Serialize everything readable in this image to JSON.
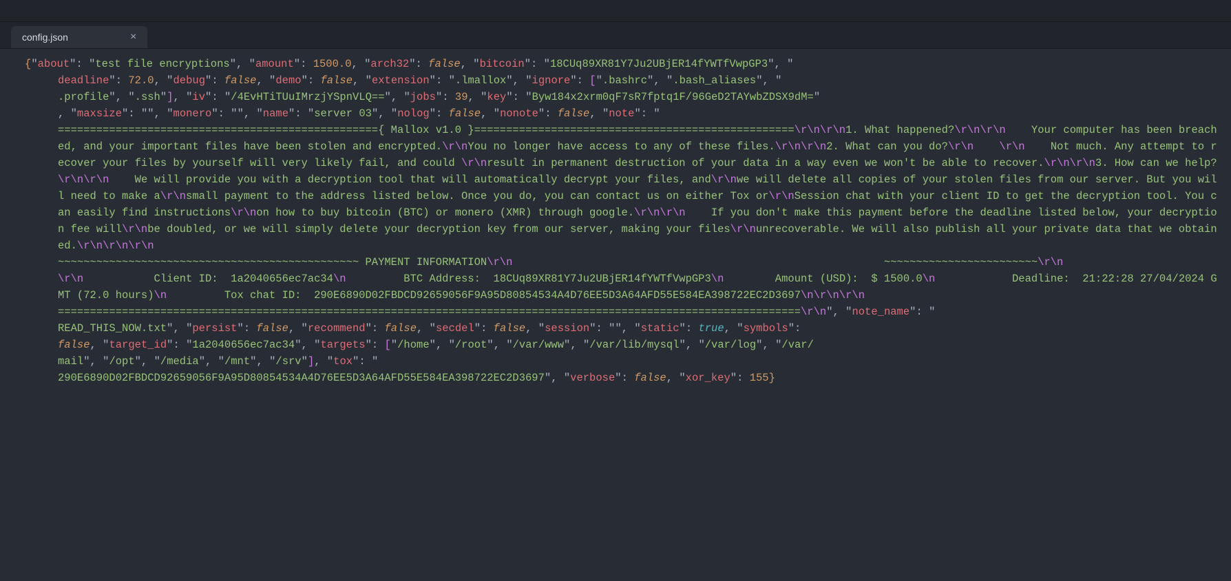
{
  "tab": {
    "filename": "config.json",
    "close_glyph": "×"
  },
  "json": {
    "about_key": "about",
    "about_val": "test file encryptions",
    "amount_key": "amount",
    "amount_val": "1500.0",
    "arch32_key": "arch32",
    "arch32_val": "false",
    "bitcoin_key": "bitcoin",
    "bitcoin_val": "18CUq89XR81Y7Ju2UBjER14fYWTfVwpGP3",
    "deadline_key": "deadline",
    "deadline_val": "72.0",
    "debug_key": "debug",
    "debug_val": "false",
    "demo_key": "demo",
    "demo_val": "false",
    "extension_key": "extension",
    "extension_val": ".lmallox",
    "ignore_key": "ignore",
    "ignore_vals": [
      ".bashrc",
      ".bash_aliases",
      ".profile",
      ".ssh"
    ],
    "iv_key": "iv",
    "iv_val": "/4EvHTiTUuIMrzjYSpnVLQ==",
    "jobs_key": "jobs",
    "jobs_val": "39",
    "key_key": "key",
    "key_val": "Byw184x2xrm0qF7sR7fptq1F/96GeD2TAYwbZDSX9dM=",
    "maxsize_key": "maxsize",
    "maxsize_val": "",
    "monero_key": "monero",
    "monero_val": "",
    "name_key": "name",
    "name_val": "server 03",
    "nolog_key": "nolog",
    "nolog_val": "false",
    "nonote_key": "nonote",
    "nonote_val": "false",
    "note_key": "note",
    "note_seg1": "=================================================={ Mallox v1.0 }==================================================",
    "note_seg2": "1. What happened?",
    "note_seg3": "    Your computer has been breached, and your important files have been stolen and encrypted.",
    "note_seg4": "You no longer have access to any of these files.",
    "note_seg5": "2. What can you do?",
    "note_seg5b": "    ",
    "note_seg6": "    Not much. Any attempt to recover your files by yourself will very likely fail, and could ",
    "note_seg7": "result in permanent destruction of your data in a way even we won't be able to recover.",
    "note_seg8": "3. How can we help?",
    "note_seg9": "    We will provide you with a decryption tool that will automatically decrypt your files, and",
    "note_seg10": "we will delete all copies of your stolen files from our server. But you will need to make a",
    "note_seg11": "small payment to the address listed below. Once you do, you can contact us on either Tox or",
    "note_seg12": "Session chat with your client ID to get the decryption tool. You can easily find instructions",
    "note_seg13": "on how to buy bitcoin (BTC) or monero (XMR) through google.",
    "note_seg14": "    If you don't make this payment before the deadline listed below, your decryption fee will",
    "note_seg15": "be doubled, or we will simply delete your decryption key from our server, making your files",
    "note_seg16": "unrecoverable. We will also publish all your private data that we obtained.",
    "note_seg17": "~~~~~~~~~~~~~~~~~~~~~~~~~~~~~~~~~~~~~~~~~~~~~~~ PAYMENT INFORMATION",
    "note_seg17b": "                                                          ~~~~~~~~~~~~~~~~~~~~~~~~",
    "note_seg18": "           Client ID:  1a2040656ec7ac34",
    "note_seg19": "         BTC Address:  18CUq89XR81Y7Ju2UBjER14fYWTfVwpGP3",
    "note_seg20": "        Amount (USD):  $ 1500.0",
    "note_seg21": "            Deadline:  21:22:28 27/04/2024 GMT (72.0 hours)",
    "note_seg22": "         Tox chat ID:  290E6890D02FBDCD92659056F9A95D80854534A4D76EE5D3A64AFD55E584EA398722EC2D3697",
    "note_last_eq": "====================================================================================================================",
    "note_name_key": "note_name",
    "note_name_val": "READ_THIS_NOW.txt",
    "persist_key": "persist",
    "persist_val": "false",
    "recommend_key": "recommend",
    "recommend_val": "false",
    "secdel_key": "secdel",
    "secdel_val": "false",
    "session_key": "session",
    "session_val": "",
    "static_key": "static",
    "static_val": "true",
    "symbols_key": "symbols",
    "symbols_val": "false",
    "target_id_key": "target_id",
    "target_id_val": "1a2040656ec7ac34",
    "targets_key": "targets",
    "targets_vals": [
      "/home",
      "/root",
      "/var/www",
      "/var/lib/mysql",
      "/var/log",
      "/var/mail",
      "/opt",
      "/media",
      "/mnt",
      "/srv"
    ],
    "tox_key": "tox",
    "tox_val": "290E6890D02FBDCD92659056F9A95D80854534A4D76EE5D3A64AFD55E584EA398722EC2D3697",
    "verbose_key": "verbose",
    "verbose_val": "false",
    "xor_key_key": "xor_key",
    "xor_key_val": "155"
  },
  "esc": {
    "rn": "\\r\\n",
    "n": "\\n"
  }
}
